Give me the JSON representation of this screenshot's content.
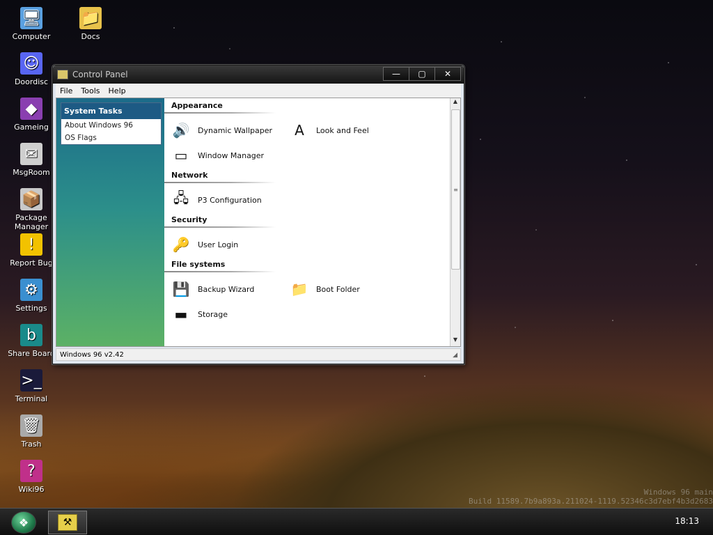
{
  "desktop": {
    "icons": [
      {
        "label": "Computer",
        "glyph": "🖥",
        "icon_name": "computer-icon"
      },
      {
        "label": "Doordisc",
        "glyph": "☺",
        "icon_name": "doordisc-icon"
      },
      {
        "label": "Gameing",
        "glyph": "◆",
        "icon_name": "gameing-icon"
      },
      {
        "label": "MsgRoom",
        "glyph": "✉",
        "icon_name": "msgroom-icon"
      },
      {
        "label": "Package Manager",
        "glyph": "📦",
        "icon_name": "package-manager-icon"
      },
      {
        "label": "Report Bug",
        "glyph": "!",
        "icon_name": "report-bug-icon"
      },
      {
        "label": "Settings",
        "glyph": "⚙",
        "icon_name": "settings-icon"
      },
      {
        "label": "Share Board",
        "glyph": "b",
        "icon_name": "share-board-icon"
      },
      {
        "label": "Terminal",
        "glyph": ">_",
        "icon_name": "terminal-icon"
      },
      {
        "label": "Trash",
        "glyph": "🗑",
        "icon_name": "trash-icon"
      },
      {
        "label": "Wiki96",
        "glyph": "?",
        "icon_name": "wiki96-icon"
      }
    ],
    "docs_icon": {
      "label": "Docs",
      "glyph": "📁",
      "icon_name": "docs-folder-icon"
    }
  },
  "window": {
    "title": "Control Panel",
    "buttons": {
      "minimize": "—",
      "maximize": "▢",
      "close": "✕"
    },
    "menu": [
      "File",
      "Tools",
      "Help"
    ],
    "sidebar": {
      "heading": "System Tasks",
      "items": [
        "About Windows 96",
        "OS Flags"
      ]
    },
    "sections": [
      {
        "title": "Appearance",
        "items": [
          {
            "label": "Dynamic Wallpaper",
            "glyph": "🔊",
            "icon_name": "dynamic-wallpaper-icon"
          },
          {
            "label": "Look and Feel",
            "glyph": "A",
            "icon_name": "look-and-feel-icon"
          },
          {
            "label": "Window Manager",
            "glyph": "▭",
            "icon_name": "window-manager-icon"
          }
        ]
      },
      {
        "title": "Network",
        "items": [
          {
            "label": "P3 Configuration",
            "glyph": "🖧",
            "icon_name": "p3-configuration-icon"
          }
        ]
      },
      {
        "title": "Security",
        "items": [
          {
            "label": "User Login",
            "glyph": "🔑",
            "icon_name": "user-login-icon"
          }
        ]
      },
      {
        "title": "File systems",
        "items": [
          {
            "label": "Backup Wizard",
            "glyph": "💾",
            "icon_name": "backup-wizard-icon"
          },
          {
            "label": "Boot Folder",
            "glyph": "📁",
            "icon_name": "boot-folder-icon"
          },
          {
            "label": "Storage",
            "glyph": "▬",
            "icon_name": "storage-icon"
          }
        ]
      }
    ],
    "status": "Windows 96 v2.42"
  },
  "taskbar": {
    "clock": "18:13",
    "start_glyph": "❖",
    "task_glyph": "⚒"
  },
  "watermark": {
    "line1": "Windows 96 main",
    "line2": "Build 11589.7b9a893a.211024-1119.52346c3d7ebf4b3d2683"
  }
}
